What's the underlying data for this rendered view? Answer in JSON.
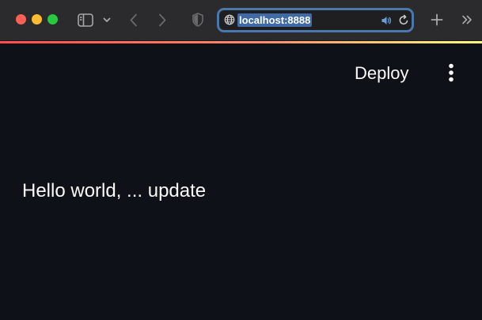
{
  "browser": {
    "url": "localhost:8888",
    "icons": {
      "sidebar": "sidebar-icon",
      "sidebar_menu": "chevron-down-icon",
      "back": "chevron-left-icon",
      "forward": "chevron-right-icon",
      "privacy": "shield-icon",
      "site": "globe-icon",
      "audio": "speaker-icon",
      "reload": "reload-icon",
      "new_tab": "plus-icon",
      "overflow": "double-chevron-right-icon"
    },
    "colors": {
      "close": "#fe5f57",
      "minimize": "#febc2e",
      "maximize": "#28c840",
      "url_focus_ring": "#4a78ad"
    }
  },
  "app": {
    "header": {
      "deploy_label": "Deploy",
      "menu_icon": "vertical-ellipsis-icon"
    },
    "content": {
      "text": "Hello world, ... update"
    },
    "colors": {
      "background": "#0e1117",
      "text": "#fafafa",
      "decoration_gradient": [
        "#ff4b4b",
        "#fffd80"
      ]
    }
  }
}
